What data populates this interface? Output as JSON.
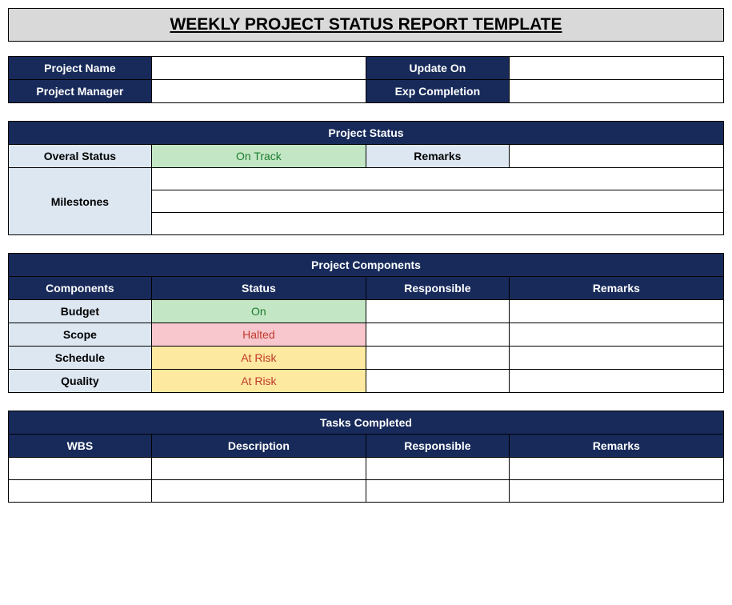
{
  "title": "WEEKLY PROJECT STATUS REPORT TEMPLATE",
  "info": {
    "projectName_label": "Project Name",
    "projectName_value": "",
    "updateOn_label": "Update On",
    "updateOn_value": "",
    "projectManager_label": "Project Manager",
    "projectManager_value": "",
    "expCompletion_label": "Exp Completion",
    "expCompletion_value": ""
  },
  "statusSection": {
    "header": "Project Status",
    "overallStatus_label": "Overal Status",
    "overallStatus_value": "On Track",
    "remarks_label": "Remarks",
    "remarks_value": "",
    "milestones_label": "Milestones",
    "milestone_row1": "",
    "milestone_row2": "",
    "milestone_row3": ""
  },
  "componentsSection": {
    "header": "Project Components",
    "col_components": "Components",
    "col_status": "Status",
    "col_responsible": "Responsible",
    "col_remarks": "Remarks",
    "rows": [
      {
        "component": "Budget",
        "status": "On",
        "status_class": "green-cell",
        "responsible": "",
        "remarks": ""
      },
      {
        "component": "Scope",
        "status": "Halted",
        "status_class": "pink-cell",
        "responsible": "",
        "remarks": ""
      },
      {
        "component": "Schedule",
        "status": "At Risk",
        "status_class": "yellow-cell",
        "responsible": "",
        "remarks": ""
      },
      {
        "component": "Quality",
        "status": "At Risk",
        "status_class": "yellow-cell",
        "responsible": "",
        "remarks": ""
      }
    ]
  },
  "tasksSection": {
    "header": "Tasks Completed",
    "col_wbs": "WBS",
    "col_description": "Description",
    "col_responsible": "Responsible",
    "col_remarks": "Remarks",
    "rows": [
      {
        "wbs": "",
        "description": "",
        "responsible": "",
        "remarks": ""
      },
      {
        "wbs": "",
        "description": "",
        "responsible": "",
        "remarks": ""
      }
    ]
  }
}
